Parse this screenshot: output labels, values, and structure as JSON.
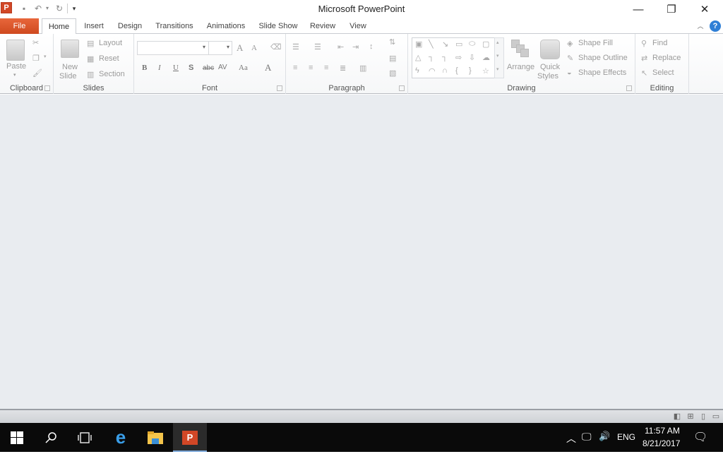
{
  "window": {
    "title": "Microsoft PowerPoint",
    "app_icon": "P",
    "qat": {
      "save": "save-icon",
      "undo": "undo-icon",
      "redo": "redo-icon",
      "customize": "customize-icon"
    },
    "controls": {
      "minimize": "—",
      "restore": "❐",
      "close": "✕"
    }
  },
  "tabs": [
    {
      "label": "File"
    },
    {
      "label": "Home"
    },
    {
      "label": "Insert"
    },
    {
      "label": "Design"
    },
    {
      "label": "Transitions"
    },
    {
      "label": "Animations"
    },
    {
      "label": "Slide Show"
    },
    {
      "label": "Review"
    },
    {
      "label": "View"
    }
  ],
  "ribbon": {
    "clipboard": {
      "label": "Clipboard",
      "paste": "Paste"
    },
    "slides": {
      "label": "Slides",
      "new_slide_1": "New",
      "new_slide_2": "Slide",
      "layout": "Layout",
      "reset": "Reset",
      "section": "Section"
    },
    "font": {
      "label": "Font",
      "font_name": "",
      "font_size": "",
      "bold": "B",
      "italic": "I",
      "underline": "U",
      "shadow": "S",
      "strike": "abc",
      "spacing": "AV",
      "case": "Aa",
      "color": "A",
      "grow": "A",
      "shrink": "A"
    },
    "paragraph": {
      "label": "Paragraph"
    },
    "drawing": {
      "label": "Drawing",
      "arrange": "Arrange",
      "quick_1": "Quick",
      "quick_2": "Styles",
      "shape_fill": "Shape Fill",
      "shape_outline": "Shape Outline",
      "shape_effects": "Shape Effects"
    },
    "editing": {
      "label": "Editing",
      "find": "Find",
      "replace": "Replace",
      "select": "Select"
    }
  },
  "status": {
    "views": [
      "normal-view-icon",
      "slide-sorter-icon",
      "reading-view-icon",
      "slideshow-icon"
    ]
  },
  "taskbar": {
    "tray": {
      "language": "ENG",
      "time": "11:57 AM",
      "date": "8/21/2017"
    }
  }
}
